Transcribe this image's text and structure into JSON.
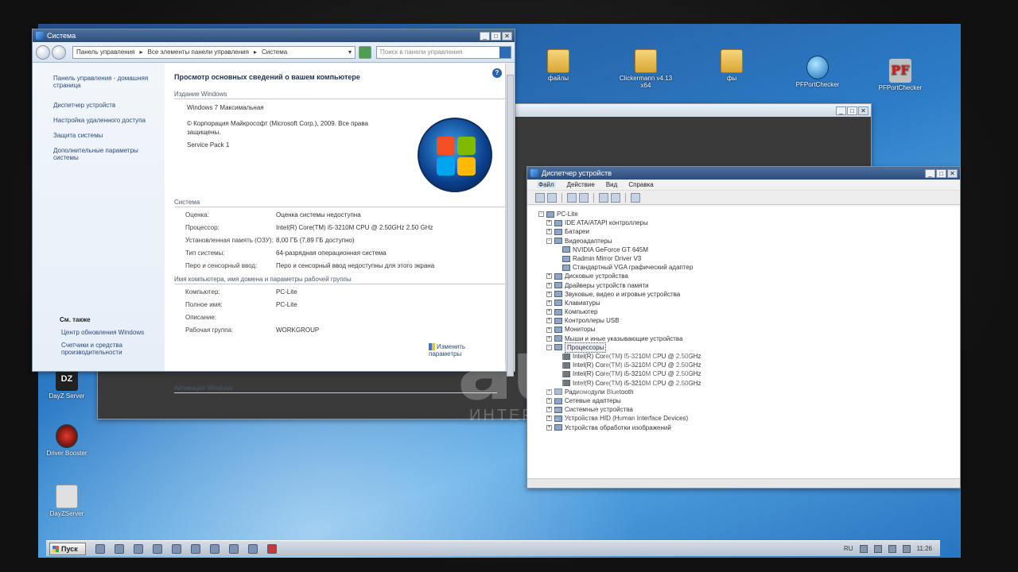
{
  "desktop": {
    "icons_top": [
      {
        "label": "файлы",
        "kind": "folder"
      },
      {
        "label": "Clickermann v4.13 x64",
        "kind": "folder"
      },
      {
        "label": "фы",
        "kind": "folder"
      },
      {
        "label": "PFPortChecker",
        "kind": "globe"
      },
      {
        "label": "PFPortChecker",
        "kind": "pf",
        "glyph": "PF"
      }
    ],
    "icons_left": [
      {
        "label": "DayZ Server",
        "glyph": "DZ"
      },
      {
        "label": "Driver Booster"
      },
      {
        "label": "DayZServer"
      }
    ]
  },
  "system_window": {
    "title": "Система",
    "breadcrumb": [
      "Панель управления",
      "Все элементы панели управления",
      "Система"
    ],
    "search_placeholder": "Поиск в панели управления",
    "left_links": [
      "Панель управления - домашняя страница",
      "Диспетчер устройств",
      "Настройка удаленного доступа",
      "Защита системы",
      "Дополнительные параметры системы"
    ],
    "see_also": "См. также",
    "see_also_links": [
      "Центр обновления Windows",
      "Счетчики и средства производительности"
    ],
    "heading": "Просмотр основных сведений о вашем компьютере",
    "edition_section": "Издание Windows",
    "edition": "Windows 7 Максимальная",
    "copyright": "© Корпорация Майкрософт (Microsoft Corp.), 2009. Все права защищены.",
    "service_pack": "Service Pack 1",
    "system_section": "Система",
    "system_rows": [
      {
        "k": "Оценка:",
        "v": "Оценка системы недоступна"
      },
      {
        "k": "Процессор:",
        "v": "Intel(R) Core(TM) i5-3210M CPU @ 2.50GHz   2.50 GHz"
      },
      {
        "k": "Установленная память (ОЗУ):",
        "v": "8,00 ГБ (7,89 ГБ доступно)"
      },
      {
        "k": "Тип системы:",
        "v": "64-разрядная операционная система"
      },
      {
        "k": "Перо и сенсорный ввод:",
        "v": "Перо и сенсорный ввод недоступны для этого экрана"
      }
    ],
    "name_section": "Имя компьютера, имя домена и параметры рабочей группы",
    "name_rows": [
      {
        "k": "Компьютер:",
        "v": "PC-Lite"
      },
      {
        "k": "Полное имя:",
        "v": "PC-Lite"
      },
      {
        "k": "Описание:",
        "v": ""
      },
      {
        "k": "Рабочая группа:",
        "v": "WORKGROUP"
      }
    ],
    "change_link": "Изменить параметры",
    "activation_section": "Активация Windows"
  },
  "device_manager": {
    "title": "Диспетчер устройств",
    "menu": [
      "Файл",
      "Действие",
      "Вид",
      "Справка"
    ],
    "tree": [
      {
        "label": "PC-Lite",
        "level": 0,
        "exp": "-"
      },
      {
        "label": "IDE ATA/ATAPI контроллеры",
        "level": 1,
        "exp": "+"
      },
      {
        "label": "Батареи",
        "level": 1,
        "exp": "+"
      },
      {
        "label": "Видеоадаптеры",
        "level": 1,
        "exp": "-"
      },
      {
        "label": "NVIDIA GeForce GT 645M",
        "level": 2
      },
      {
        "label": "Radmin Mirror Driver V3",
        "level": 2
      },
      {
        "label": "Стандартный VGA графический адаптер",
        "level": 2
      },
      {
        "label": "Дисковые устройства",
        "level": 1,
        "exp": "+"
      },
      {
        "label": "Драйверы устройств памяти",
        "level": 1,
        "exp": "+"
      },
      {
        "label": "Звуковые, видео и игровые устройства",
        "level": 1,
        "exp": "+"
      },
      {
        "label": "Клавиатуры",
        "level": 1,
        "exp": "+"
      },
      {
        "label": "Компьютер",
        "level": 1,
        "exp": "+"
      },
      {
        "label": "Контроллеры USB",
        "level": 1,
        "exp": "+"
      },
      {
        "label": "Мониторы",
        "level": 1,
        "exp": "+"
      },
      {
        "label": "Мыши и иные указывающие устройства",
        "level": 1,
        "exp": "+"
      },
      {
        "label": "Процессоры",
        "level": 1,
        "exp": "-",
        "selected": true
      },
      {
        "label": "Intel(R) Core(TM) i5-3210M CPU @ 2.50GHz",
        "level": 2,
        "chip": true
      },
      {
        "label": "Intel(R) Core(TM) i5-3210M CPU @ 2.50GHz",
        "level": 2,
        "chip": true
      },
      {
        "label": "Intel(R) Core(TM) i5-3210M CPU @ 2.50GHz",
        "level": 2,
        "chip": true
      },
      {
        "label": "Intel(R) Core(TM) i5-3210M CPU @ 2.50GHz",
        "level": 2,
        "chip": true
      },
      {
        "label": "Радиомодули Bluetooth",
        "level": 1,
        "exp": "+"
      },
      {
        "label": "Сетевые адаптеры",
        "level": 1,
        "exp": "+"
      },
      {
        "label": "Системные устройства",
        "level": 1,
        "exp": "+"
      },
      {
        "label": "Устройства HID (Human Interface Devices)",
        "level": 1,
        "exp": "+"
      },
      {
        "label": "Устройства обработки изображений",
        "level": 1,
        "exp": "+"
      }
    ]
  },
  "taskbar": {
    "start": "Пуск",
    "lang": "RU",
    "clock": "11:26"
  },
  "watermark": {
    "main": "au.ru",
    "sub": "ИНТЕРНЕТ-АУКЦИОН"
  }
}
